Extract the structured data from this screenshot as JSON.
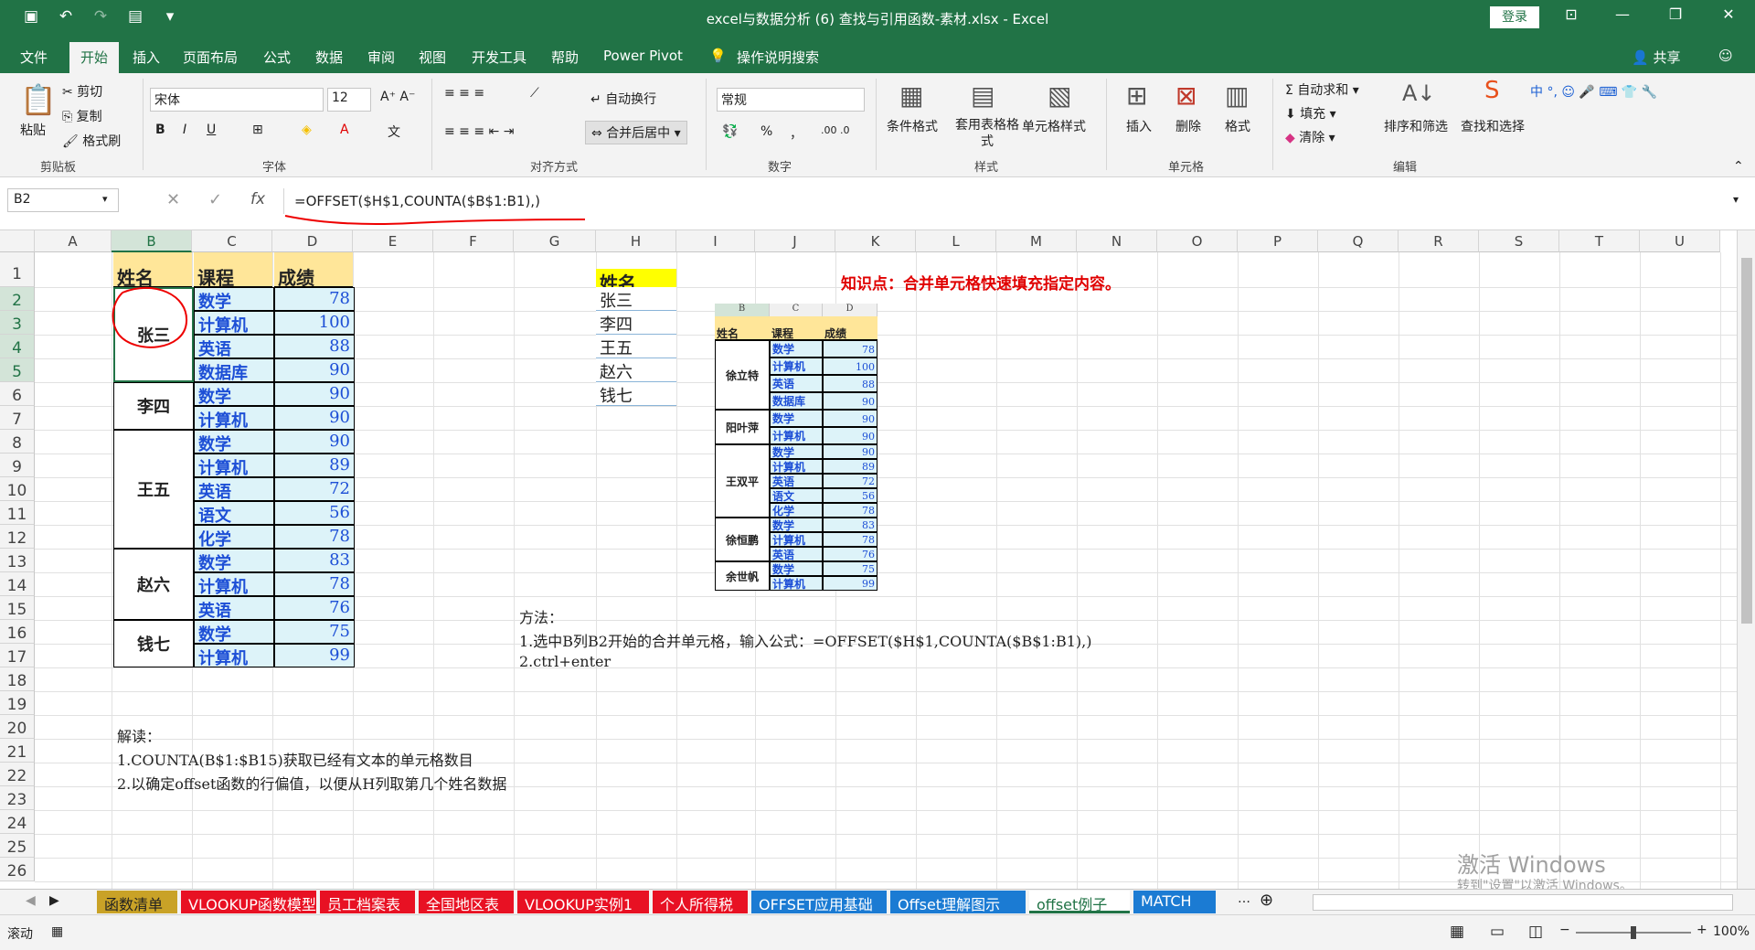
{
  "titlebar": {
    "title": "excel与数据分析 (6) 查找与引用函数-素材.xlsx - Excel",
    "login": "登录",
    "qat_icons": [
      "save-icon",
      "undo-icon",
      "redo-icon",
      "form-icon",
      "customize-icon"
    ]
  },
  "menu": {
    "items": [
      "文件",
      "开始",
      "插入",
      "页面布局",
      "公式",
      "数据",
      "审阅",
      "视图",
      "开发工具",
      "帮助",
      "Power Pivot",
      "操作说明搜索"
    ],
    "share": "共享"
  },
  "ribbon": {
    "clipboard": {
      "paste": "粘贴",
      "cut": "剪切",
      "copy": "复制",
      "format_painter": "格式刷",
      "label": "剪贴板"
    },
    "font": {
      "name": "宋体",
      "size": "12",
      "bold": "B",
      "italic": "I",
      "underline": "U",
      "label": "字体"
    },
    "align": {
      "wrap": "自动换行",
      "merge": "合并后居中",
      "label": "对齐方式"
    },
    "number": {
      "format": "常规",
      "percent": "%",
      "comma": "，",
      "label": "数字"
    },
    "styles": {
      "conditional": "条件格式",
      "table": "套用表格格式",
      "cell": "单元格样式",
      "label": "样式"
    },
    "cells": {
      "insert": "插入",
      "delete": "删除",
      "format": "格式",
      "label": "单元格"
    },
    "edit": {
      "autosum": "自动求和",
      "fill": "填充",
      "clear": "清除",
      "sort": "排序和筛选",
      "find": "查找和选择",
      "label": "编辑"
    }
  },
  "formula_bar": {
    "namebox": "B2",
    "fx": "fx",
    "formula": "=OFFSET($H$1,COUNTA($B$1:B1),)"
  },
  "columns": [
    "A",
    "B",
    "C",
    "D",
    "E",
    "F",
    "G",
    "H",
    "I",
    "J",
    "K",
    "L",
    "M",
    "N",
    "O",
    "P",
    "Q",
    "R",
    "S",
    "T",
    "U"
  ],
  "rows": [
    "1",
    "2",
    "3",
    "4",
    "5",
    "6",
    "7",
    "8",
    "9",
    "10",
    "11",
    "12",
    "13",
    "14",
    "15",
    "16",
    "17",
    "18",
    "19",
    "20",
    "21",
    "22",
    "23",
    "24",
    "25",
    "26"
  ],
  "main_table": {
    "headers": [
      "姓名",
      "课程",
      "成绩"
    ],
    "groups": [
      {
        "name": "张三",
        "rows": [
          [
            "数学",
            "78"
          ],
          [
            "计算机",
            "100"
          ],
          [
            "英语",
            "88"
          ],
          [
            "数据库",
            "90"
          ]
        ]
      },
      {
        "name": "李四",
        "rows": [
          [
            "数学",
            "90"
          ],
          [
            "计算机",
            "90"
          ]
        ]
      },
      {
        "name": "王五",
        "rows": [
          [
            "数学",
            "90"
          ],
          [
            "计算机",
            "89"
          ],
          [
            "英语",
            "72"
          ],
          [
            "语文",
            "56"
          ],
          [
            "化学",
            "78"
          ]
        ]
      },
      {
        "name": "赵六",
        "rows": [
          [
            "数学",
            "83"
          ],
          [
            "计算机",
            "78"
          ],
          [
            "英语",
            "76"
          ]
        ]
      },
      {
        "name": "钱七",
        "rows": [
          [
            "数学",
            "75"
          ],
          [
            "计算机",
            "99"
          ]
        ]
      }
    ]
  },
  "name_list": {
    "header": "姓名",
    "names": [
      "张三",
      "李四",
      "王五",
      "赵六",
      "钱七"
    ]
  },
  "knowledge": "知识点：合并单元格快速填充指定内容。",
  "method": [
    "方法：",
    "1.选中B列B2开始的合并单元格，输入公式：=OFFSET($H$1,COUNTA($B$1:B1),)",
    "2.ctrl+enter"
  ],
  "explain": [
    "解读：",
    "1.COUNTA(B$1:$B15)获取已经有文本的单元格数目",
    "2.以确定offset函数的行偏值，以便从H列取第几个姓名数据"
  ],
  "mini_table": {
    "cols": [
      "B",
      "C",
      "D"
    ],
    "headers": [
      "姓名",
      "课程",
      "成绩"
    ],
    "groups": [
      {
        "name": "徐立特",
        "rows": [
          [
            "数学",
            "78"
          ],
          [
            "计算机",
            "100"
          ],
          [
            "英语",
            "88"
          ],
          [
            "数据库",
            "90"
          ]
        ]
      },
      {
        "name": "阳叶萍",
        "rows": [
          [
            "数学",
            "90"
          ],
          [
            "计算机",
            "90"
          ]
        ]
      },
      {
        "name": "王双平",
        "rows": [
          [
            "数学",
            "90"
          ],
          [
            "计算机",
            "89"
          ],
          [
            "英语",
            "72"
          ],
          [
            "语文",
            "56"
          ],
          [
            "化学",
            "78"
          ]
        ]
      },
      {
        "name": "徐恒鹏",
        "rows": [
          [
            "数学",
            "83"
          ],
          [
            "计算机",
            "78"
          ],
          [
            "英语",
            "76"
          ]
        ]
      },
      {
        "name": "余世帆",
        "rows": [
          [
            "数学",
            "75"
          ],
          [
            "计算机",
            "99"
          ]
        ]
      }
    ]
  },
  "tabs": [
    {
      "label": "函数清单",
      "color": "#c9a227",
      "fg": "#222"
    },
    {
      "label": "VLOOKUP函数模型",
      "color": "#e81123",
      "fg": "#fff"
    },
    {
      "label": "员工档案表",
      "color": "#e81123",
      "fg": "#fff"
    },
    {
      "label": "全国地区表",
      "color": "#e81123",
      "fg": "#fff"
    },
    {
      "label": "VLOOKUP实例1",
      "color": "#e81123",
      "fg": "#fff"
    },
    {
      "label": "个人所得税",
      "color": "#e81123",
      "fg": "#fff"
    },
    {
      "label": "OFFSET应用基础",
      "color": "#1b7bd3",
      "fg": "#fff"
    },
    {
      "label": "Offset理解图示",
      "color": "#1b7bd3",
      "fg": "#fff"
    },
    {
      "label": "offset例子",
      "color": "#ffffff",
      "fg": "#217346"
    },
    {
      "label": "MATCH",
      "color": "#1b7bd3",
      "fg": "#fff"
    }
  ],
  "status": {
    "mode": "滚动",
    "zoom": "100%"
  },
  "watermark": {
    "line1": "激活 Windows",
    "line2": "转到\"设置\"以激活 Windows。"
  }
}
